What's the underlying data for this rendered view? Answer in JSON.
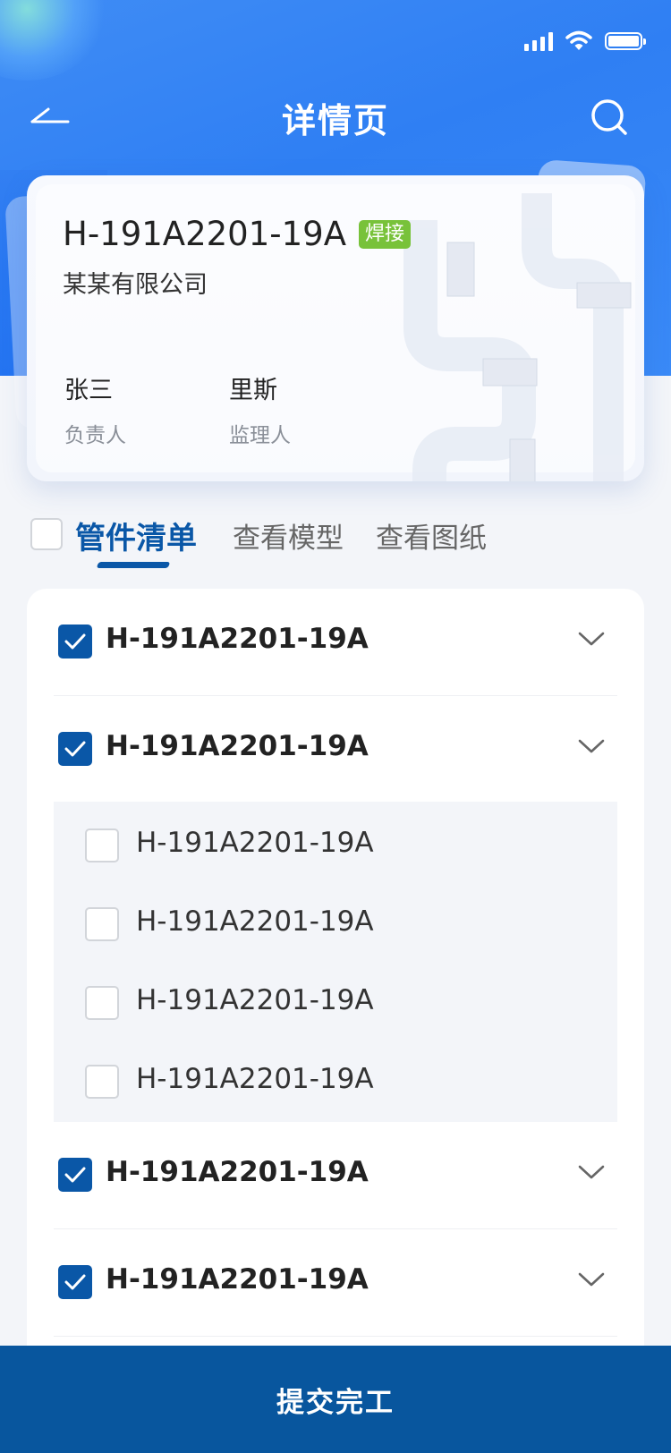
{
  "header": {
    "title": "详情页",
    "back_icon": "back-arrow-icon",
    "search_icon": "search-icon"
  },
  "card": {
    "code": "H-191A2201-19A",
    "badge": "焊接",
    "company": "某某有限公司",
    "people": [
      {
        "name": "张三",
        "role": "负责人"
      },
      {
        "name": "里斯",
        "role": "监理人"
      }
    ]
  },
  "tabs": {
    "items": [
      {
        "label": "管件清单",
        "active": true
      },
      {
        "label": "查看模型",
        "active": false
      },
      {
        "label": "查看图纸",
        "active": false
      }
    ]
  },
  "list": {
    "rows": [
      {
        "label": "H-191A2201-19A",
        "checked": true
      },
      {
        "label": "H-191A2201-19A",
        "checked": true,
        "expanded": true
      },
      {
        "label": "H-191A2201-19A",
        "checked": true
      },
      {
        "label": "H-191A2201-19A",
        "checked": true
      }
    ],
    "subitems": [
      {
        "label": "H-191A2201-19A",
        "checked": false
      },
      {
        "label": "H-191A2201-19A",
        "checked": false
      },
      {
        "label": "H-191A2201-19A",
        "checked": false
      },
      {
        "label": "H-191A2201-19A",
        "checked": false
      }
    ]
  },
  "footer": {
    "submit_label": "提交完工"
  },
  "colors": {
    "primary": "#0a57a7",
    "header_blue": "#3f8cf5",
    "badge_green": "#78c23a"
  }
}
